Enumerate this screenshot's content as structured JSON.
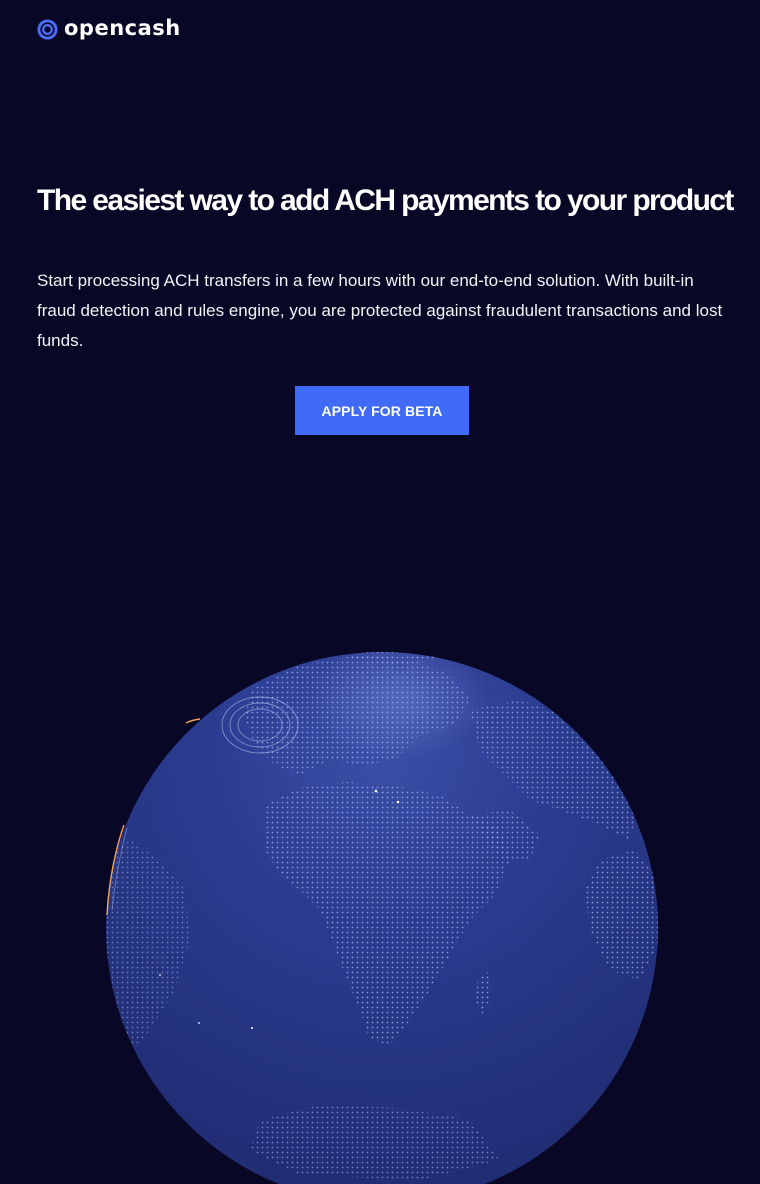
{
  "header": {
    "brand_name": "opencash",
    "logo_icon": "concentric-circles-icon",
    "brand_color": "#4a6cf7"
  },
  "hero": {
    "title": "The easiest way to add ACH payments to your product",
    "description": "Start processing ACH transfers in a few hours with our end-to-end solution. With built-in fraud detection and rules engine, you are protected against fraudulent transactions and lost funds.",
    "cta_label": "APPLY FOR BETA",
    "cta_color": "#3f6bf6"
  },
  "page": {
    "background_color": "#080725",
    "globe_color": "#2a3a8c"
  }
}
